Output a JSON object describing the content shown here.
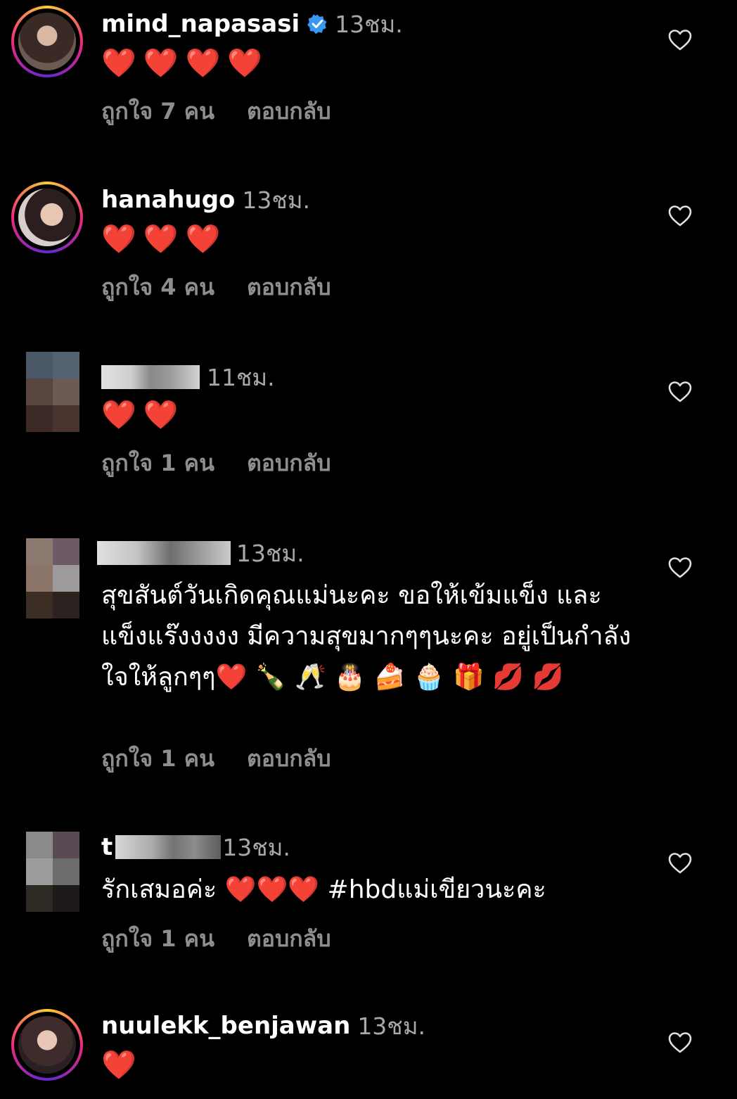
{
  "comments": [
    {
      "username": "mind_napasasi",
      "verified": true,
      "time": "13ชม.",
      "text": "❤️❤️❤️❤️",
      "likes": "ถูกใจ 7 คน",
      "reply": "ตอบกลับ"
    },
    {
      "username": "hanahugo",
      "verified": false,
      "time": "13ชม.",
      "text": "❤️❤️❤️",
      "likes": "ถูกใจ 4 คน",
      "reply": "ตอบกลับ"
    },
    {
      "username": "",
      "verified": false,
      "time": "11ชม.",
      "text": "❤️❤️",
      "likes": "ถูกใจ 1 คน",
      "reply": "ตอบกลับ"
    },
    {
      "username": "",
      "verified": false,
      "time": "13ชม.",
      "text": "สุขสันต์วันเกิดคุณแม่นะคะ ขอให้เข้มแข็ง และแข็งแร๊งงงงง มีความสุขมากๆๆนะคะ อยู่เป็นกำลังใจให้ลูกๆๆ❤️ 🍾 🥂 🎂 🍰 🧁 🎁 💋 💋",
      "likes": "ถูกใจ 1 คน",
      "reply": "ตอบกลับ"
    },
    {
      "username": "t",
      "verified": false,
      "time": "13ชม.",
      "text": "รักเสมอค่ะ ❤️❤️❤️ #hbdแม่เขียวนะคะ",
      "likes": "ถูกใจ 1 คน",
      "reply": "ตอบกลับ"
    },
    {
      "username": "nuulekk_benjawan",
      "verified": false,
      "time": "13ชม.",
      "text": "❤️"
    }
  ],
  "icons": {
    "like": "heart-outline-icon",
    "verified": "verified-badge-icon"
  },
  "colors": {
    "background": "#000000",
    "secondary_text": "#a8a8a8",
    "meta_text": "#8e8e8e",
    "verified_blue": "#3897f0",
    "heart_red": "#ff2d3f"
  }
}
